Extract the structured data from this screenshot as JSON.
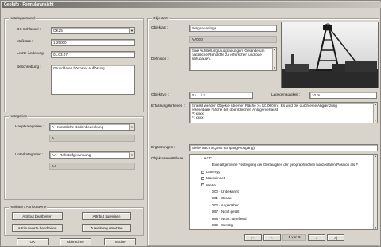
{
  "window": {
    "title": "GeoInfo - Formularansicht"
  },
  "left": {
    "catalog": {
      "title": "Katalogauswahl",
      "ok_key_label": "OK Schlüssel :",
      "ok_key_value": "OK25",
      "scale_label": "Maßstab :",
      "scale_value": "1:25000",
      "last_change_label": "Letzte Änderung :",
      "last_change_value": "01.03.07",
      "description_label": "Beschreibung :",
      "description_value": "Grunddaten höchster Auflösung"
    },
    "categories": {
      "title": "Kategorien",
      "main_label": "Hauptkategorien :",
      "main_value": "A - Künstliche Bodenbedeckung",
      "main_code": "A",
      "sub_label": "Unterkategorien :",
      "sub_value": "AA - Rohstoffgewinnung",
      "sub_code": "AA"
    },
    "attributes": {
      "title": "Attribute / Attributwerte",
      "btn_edit_attr": "Attribut bearbeiten",
      "btn_assign_attr": "Attribut zuweisen",
      "btn_edit_values": "Attributwerte bearbeiten",
      "btn_replace_assign": "Zuweisung ersetzen"
    },
    "bottom_buttons": {
      "ok": "OK",
      "cancel": "Abbrechen",
      "search": "Suche"
    }
  },
  "right": {
    "title": "Objektart",
    "object_type_label": "Objektart :",
    "object_type_value": "Bergbauanlage",
    "object_code": "AA070",
    "definition_label": "Definition :",
    "definition_value": "Eine Aufstellung/Ausgrabung im Gelände um natürliche Rohstoffe zu erforschen und/oder abzubauen.",
    "object_typ_label": "Objekttyp :",
    "object_typ_value": "P / ... / F",
    "accuracy_label": "Lagegenauigkeit :",
    "accuracy_value": "10 m",
    "criteria_label": "Erfassungskriterien :",
    "criteria_lines": [
      "Erfasst werden Objekte ab einer Fläche >= 10.000 m². Es wird die durch eine Abgrenzung",
      "erkennbare Fläche der oberirdischen Anlagen erfasst.",
      "P: xxxx",
      "F: xxxx"
    ],
    "supplement_label": "Ergänzungen :",
    "supplement_value": "Siehe auch AQ090 (Eingang/Ausgang).",
    "attributes_label": "Objektartenattribute :",
    "tree": [
      {
        "text": "ACC",
        "indent": 1,
        "exp": ""
      },
      {
        "text": "Eine allgemeine Festlegung der Genauigkeit der geographischen horizontalen Position als F",
        "indent": 2,
        "exp": ""
      },
      {
        "text": "Datentyp",
        "indent": 1,
        "exp": "+"
      },
      {
        "text": "Masseinheit",
        "indent": 1,
        "exp": "+"
      },
      {
        "text": "Werte",
        "indent": 1,
        "exp": "−"
      },
      {
        "text": "000 - Unbekannt",
        "indent": 2,
        "exp": ""
      },
      {
        "text": "001 - Genau",
        "indent": 2,
        "exp": ""
      },
      {
        "text": "002 - Angenähert",
        "indent": 2,
        "exp": ""
      },
      {
        "text": "997 - Nicht gefüllt",
        "indent": 2,
        "exp": ""
      },
      {
        "text": "998 - Nicht zutreffend",
        "indent": 2,
        "exp": ""
      },
      {
        "text": "999 - Sonstig",
        "indent": 2,
        "exp": ""
      }
    ],
    "nav": {
      "first": "|<",
      "prev": "<",
      "record": "1 von 8",
      "next": ">",
      "last": ">|"
    }
  }
}
